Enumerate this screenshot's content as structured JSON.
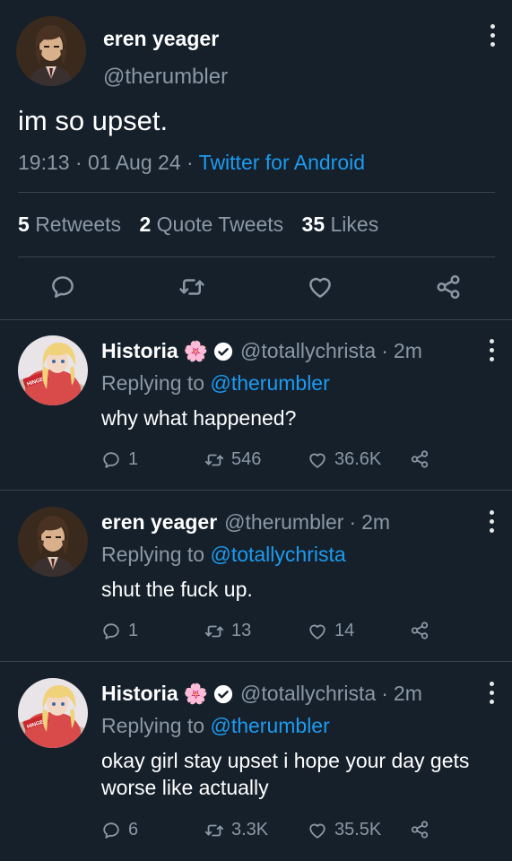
{
  "main": {
    "name": "eren yeager",
    "handle": "@therumbler",
    "text": "im so upset.",
    "time": "19:13",
    "date": "01 Aug 24",
    "source": "Twitter for Android",
    "retweets_count": "5",
    "retweets_label": "Retweets",
    "quotes_count": "2",
    "quotes_label": "Quote Tweets",
    "likes_count": "35",
    "likes_label": "Likes"
  },
  "replies": [
    {
      "name": "Historia",
      "emoji": "🌸",
      "verified": true,
      "handle": "@totallychrista",
      "time": "2m",
      "replying_prefix": "Replying to",
      "replying_to": "@therumbler",
      "text": "why what happened?",
      "replies": "1",
      "retweets": "546",
      "likes": "36.6K"
    },
    {
      "name": "eren yeager",
      "handle": "@therumbler",
      "time": "2m",
      "replying_prefix": "Replying to",
      "replying_to": "@totallychrista",
      "text": "shut the fuck up.",
      "replies": "1",
      "retweets": "13",
      "likes": "14"
    },
    {
      "name": "Historia",
      "emoji": "🌸",
      "verified": true,
      "handle": "@totallychrista",
      "time": "2m",
      "replying_prefix": "Replying to",
      "replying_to": "@therumbler",
      "text": "okay girl stay upset i hope your day gets worse like actually",
      "replies": "6",
      "retweets": "3.3K",
      "likes": "35.5K"
    }
  ],
  "separator": "·",
  "icons": [
    "reply-icon",
    "retweet-icon",
    "like-icon",
    "share-icon",
    "verified-badge-icon",
    "more-options-icon"
  ],
  "colors": {
    "background": "#15202b",
    "accent": "#1d9bf0",
    "secondary_text": "#8b98a5",
    "divider": "#38444d"
  }
}
